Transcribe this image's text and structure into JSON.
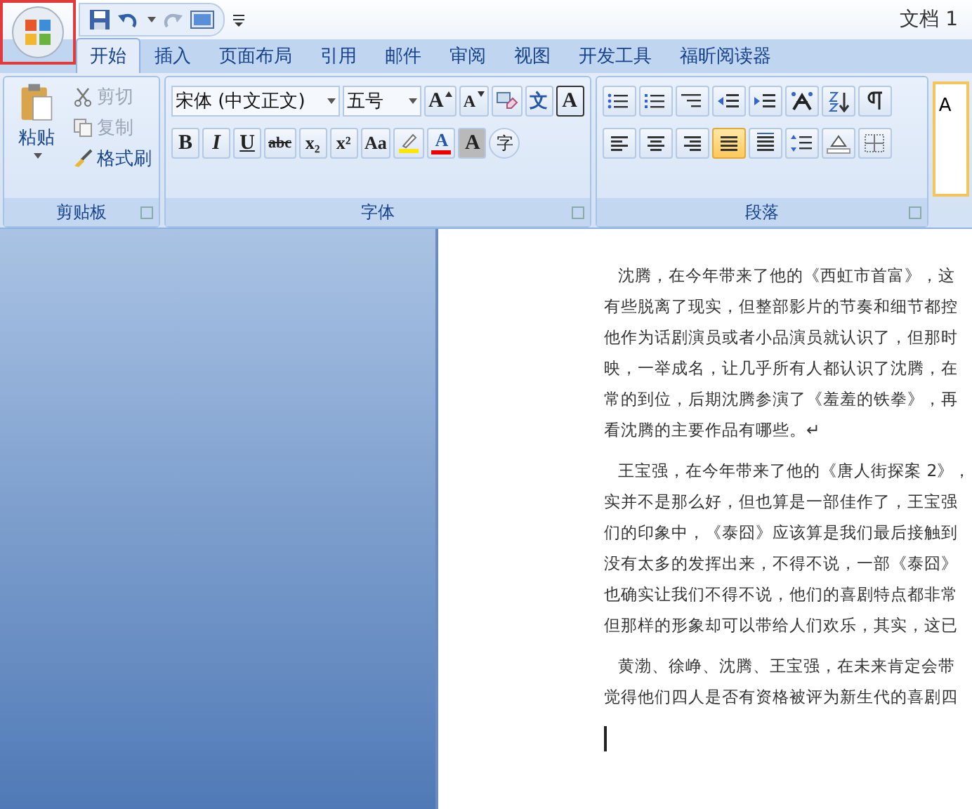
{
  "office_button": {
    "highlighted": true
  },
  "window": {
    "title": "文档 1"
  },
  "tabs": [
    {
      "label": "开始",
      "selected": true
    },
    {
      "label": "插入",
      "selected": false
    },
    {
      "label": "页面布局",
      "selected": false
    },
    {
      "label": "引用",
      "selected": false
    },
    {
      "label": "邮件",
      "selected": false
    },
    {
      "label": "审阅",
      "selected": false
    },
    {
      "label": "视图",
      "selected": false
    },
    {
      "label": "开发工具",
      "selected": false
    },
    {
      "label": "福昕阅读器",
      "selected": false
    }
  ],
  "clipboard": {
    "label": "剪贴板",
    "paste": "粘贴",
    "items": [
      {
        "kind": "cut",
        "label": "剪切",
        "disabled": true
      },
      {
        "kind": "copy",
        "label": "复制",
        "disabled": true
      },
      {
        "kind": "brush",
        "label": "格式刷",
        "disabled": false
      }
    ]
  },
  "font": {
    "label": "字体",
    "font_name": "宋体 (中文正文)",
    "font_size": "五号",
    "row1": [
      {
        "kind": "grow",
        "label": "A"
      },
      {
        "kind": "shrink",
        "label": "A"
      },
      {
        "kind": "clear"
      },
      {
        "kind": "phonetic",
        "label": "文"
      },
      {
        "kind": "border",
        "label": "A"
      }
    ],
    "row2": [
      {
        "kind": "bold",
        "label": "B"
      },
      {
        "kind": "italic",
        "label": "I"
      },
      {
        "kind": "underline",
        "label": "U"
      },
      {
        "kind": "strike",
        "label": "abc"
      },
      {
        "kind": "sub",
        "label": "x₂"
      },
      {
        "kind": "sup",
        "label": "x²"
      },
      {
        "kind": "case",
        "label": "Aa"
      },
      {
        "kind": "highlight"
      },
      {
        "kind": "color",
        "label": "A"
      },
      {
        "kind": "shade",
        "label": "A"
      },
      {
        "kind": "enclose",
        "label": "字"
      }
    ]
  },
  "paragraph": {
    "label": "段落",
    "alignments": [
      {
        "selected": false
      },
      {
        "selected": false
      },
      {
        "selected": false
      },
      {
        "selected": true
      },
      {
        "selected": false
      }
    ]
  },
  "styles": {
    "preview": "A"
  },
  "document": {
    "paragraphs": [
      {
        "lines": [
          "沈腾，在今年带来了他的《西虹市首富》，这",
          "有些脱离了现实，但整部影片的节奏和细节都控",
          "他作为话剧演员或者小品演员就认识了，但那时",
          "映，一举成名，让几乎所有人都认识了沈腾，在",
          "常的到位，后期沈腾参演了《羞羞的铁拳》，再",
          "看沈腾的主要作品有哪些。↵"
        ]
      },
      {
        "lines": [
          "王宝强，在今年带来了他的《唐人街探案 2》，",
          "实并不是那么好，但也算是一部佳作了，王宝强",
          "们的印象中，《泰囧》应该算是我们最后接触到",
          "没有太多的发挥出来，不得不说，一部《泰囧》",
          "也确实让我们不得不说，他们的喜剧特点都非常",
          "但那样的形象却可以带给人们欢乐，其实，这已"
        ]
      },
      {
        "lines": [
          "黄渤、徐峥、沈腾、王宝强，在未来肯定会带",
          "觉得他们四人是否有资格被评为新生代的喜剧四"
        ]
      }
    ]
  }
}
